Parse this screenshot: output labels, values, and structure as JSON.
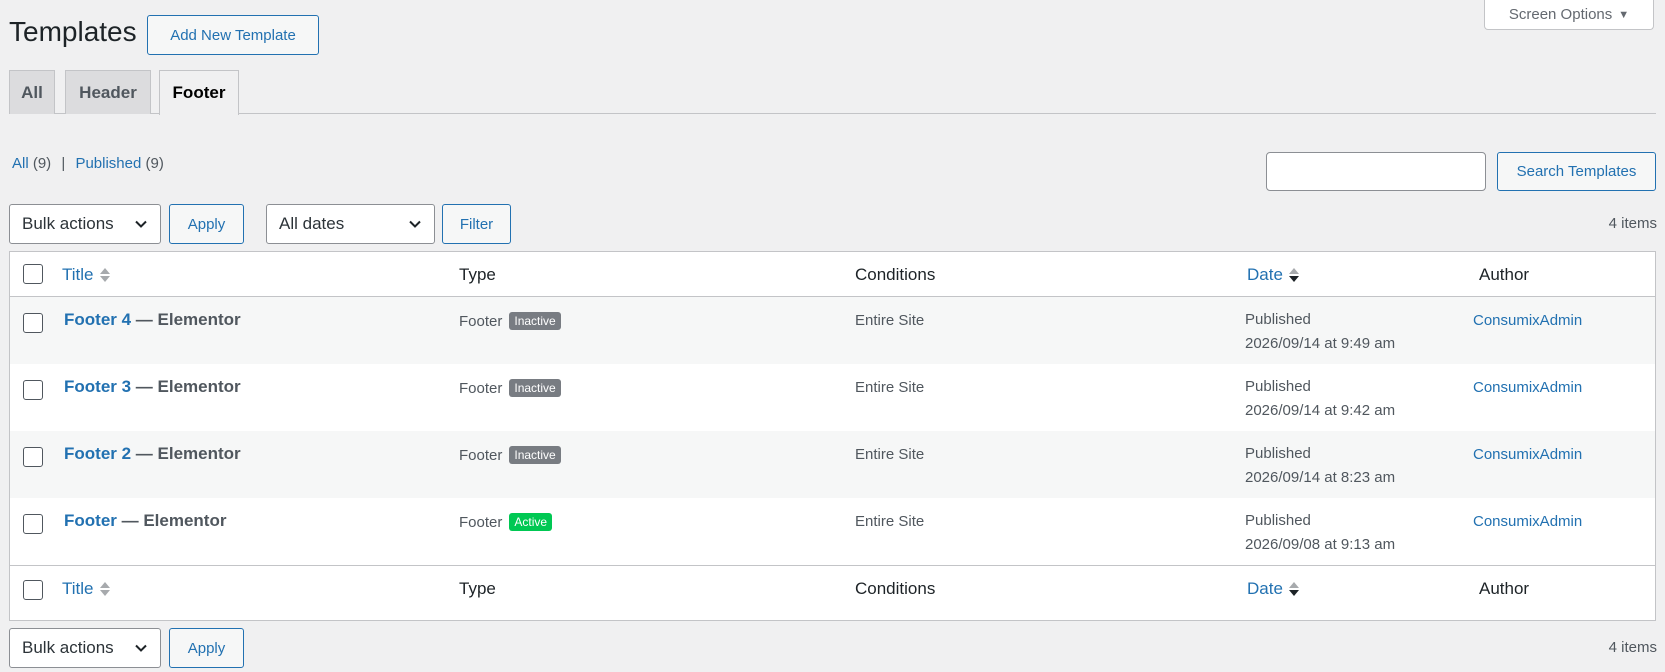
{
  "screen_options": {
    "label": "Screen Options",
    "caret": "▼"
  },
  "page": {
    "title": "Templates",
    "add_new": "Add New Template"
  },
  "tabs": [
    {
      "label": "All",
      "active": false
    },
    {
      "label": "Header",
      "active": false
    },
    {
      "label": "Footer",
      "active": true
    }
  ],
  "views": {
    "all_label": "All",
    "all_count": "(9)",
    "separator": "|",
    "published_label": "Published",
    "published_count": "(9)"
  },
  "search": {
    "placeholder": "",
    "button": "Search Templates"
  },
  "top_nav": {
    "bulk_actions": "Bulk actions",
    "apply": "Apply",
    "dates": "All dates",
    "filter": "Filter",
    "count": "4 items"
  },
  "bottom_nav": {
    "bulk_actions": "Bulk actions",
    "apply": "Apply",
    "count": "4 items"
  },
  "table": {
    "columns": {
      "title": "Title",
      "type": "Type",
      "conditions": "Conditions",
      "date": "Date",
      "author": "Author"
    },
    "rows": [
      {
        "title": "Footer 4",
        "suffix": " — Elementor",
        "type": "Footer",
        "status": "Inactive",
        "conditions": "Entire Site",
        "date_status": "Published",
        "date": "2026/09/14 at 9:49 am",
        "author": "ConsumixAdmin"
      },
      {
        "title": "Footer 3",
        "suffix": " — Elementor",
        "type": "Footer",
        "status": "Inactive",
        "conditions": "Entire Site",
        "date_status": "Published",
        "date": "2026/09/14 at 9:42 am",
        "author": "ConsumixAdmin"
      },
      {
        "title": "Footer 2",
        "suffix": " — Elementor",
        "type": "Footer",
        "status": "Inactive",
        "conditions": "Entire Site",
        "date_status": "Published",
        "date": "2026/09/14 at 8:23 am",
        "author": "ConsumixAdmin"
      },
      {
        "title": "Footer",
        "suffix": " — Elementor",
        "type": "Footer",
        "status": "Active",
        "conditions": "Entire Site",
        "date_status": "Published",
        "date": "2026/09/08 at 9:13 am",
        "author": "ConsumixAdmin"
      }
    ]
  },
  "colors": {
    "accent": "#2271b1",
    "badge_inactive": "#787c82",
    "badge_active": "#00c853"
  }
}
